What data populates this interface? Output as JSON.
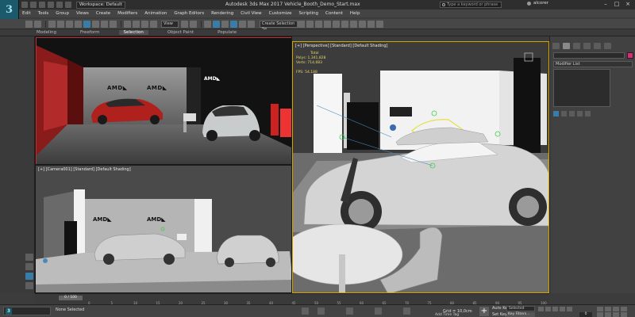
{
  "app": {
    "logo_glyph": "3",
    "title": "Autodesk 3ds Max 2017     Vehicle_Booth_Demo_Start.max",
    "workspace": "Workspace: Default",
    "search_placeholder": "Type a keyword or phrase",
    "user": "alcorer"
  },
  "menu": [
    "Edit",
    "Tools",
    "Group",
    "Views",
    "Create",
    "Modifiers",
    "Animation",
    "Graph Editors",
    "Rendering",
    "Civil View",
    "Customize",
    "Scripting",
    "Content",
    "Help"
  ],
  "toolbar": {
    "view_dropdown": "View",
    "selection_set": "Create Selection Se"
  },
  "ribbon": {
    "tabs": [
      "Modeling",
      "Freeform",
      "Selection",
      "Object Paint",
      "Populate"
    ],
    "active": "Selection"
  },
  "viewports": {
    "top_left": {
      "label": ""
    },
    "camera": {
      "label": "[+] [Camera001] [Standard] [Default Shading]"
    },
    "perspective": {
      "label": "[+] [Perspective] [Standard] [Default Shading]",
      "stats": {
        "total_label": "Total",
        "polys_label": "Polys:",
        "polys_value": "1,341,828",
        "verts_label": "Verts:",
        "verts_value": "714,683",
        "fps_label": "FPS:",
        "fps_value": "54.188"
      }
    }
  },
  "booth": {
    "brand": "AMD",
    "brand_mark": "◣"
  },
  "command_panel": {
    "modifier_list": "Modifier List",
    "object_color": "#e0287a"
  },
  "timeline": {
    "slider": "0 / 100",
    "ticks": [
      "0",
      "5",
      "10",
      "15",
      "20",
      "25",
      "30",
      "35",
      "40",
      "45",
      "50",
      "55",
      "60",
      "65",
      "70",
      "75",
      "80",
      "85",
      "90",
      "95",
      "100"
    ]
  },
  "status": {
    "selection": "None Selected",
    "prompt": "",
    "grid": "Grid = 10,0cm",
    "add_time_tag": "Add Time Tag",
    "auto_key": "Auto Key",
    "set_key": "Set Key",
    "selected": "Selected",
    "key_filters": "Key Filters...",
    "frame": "0"
  },
  "colors": {
    "active_viewport_border": "#d4a400",
    "accent_blue": "#3a7ca8",
    "selection_yellow": "#e5e04a"
  }
}
